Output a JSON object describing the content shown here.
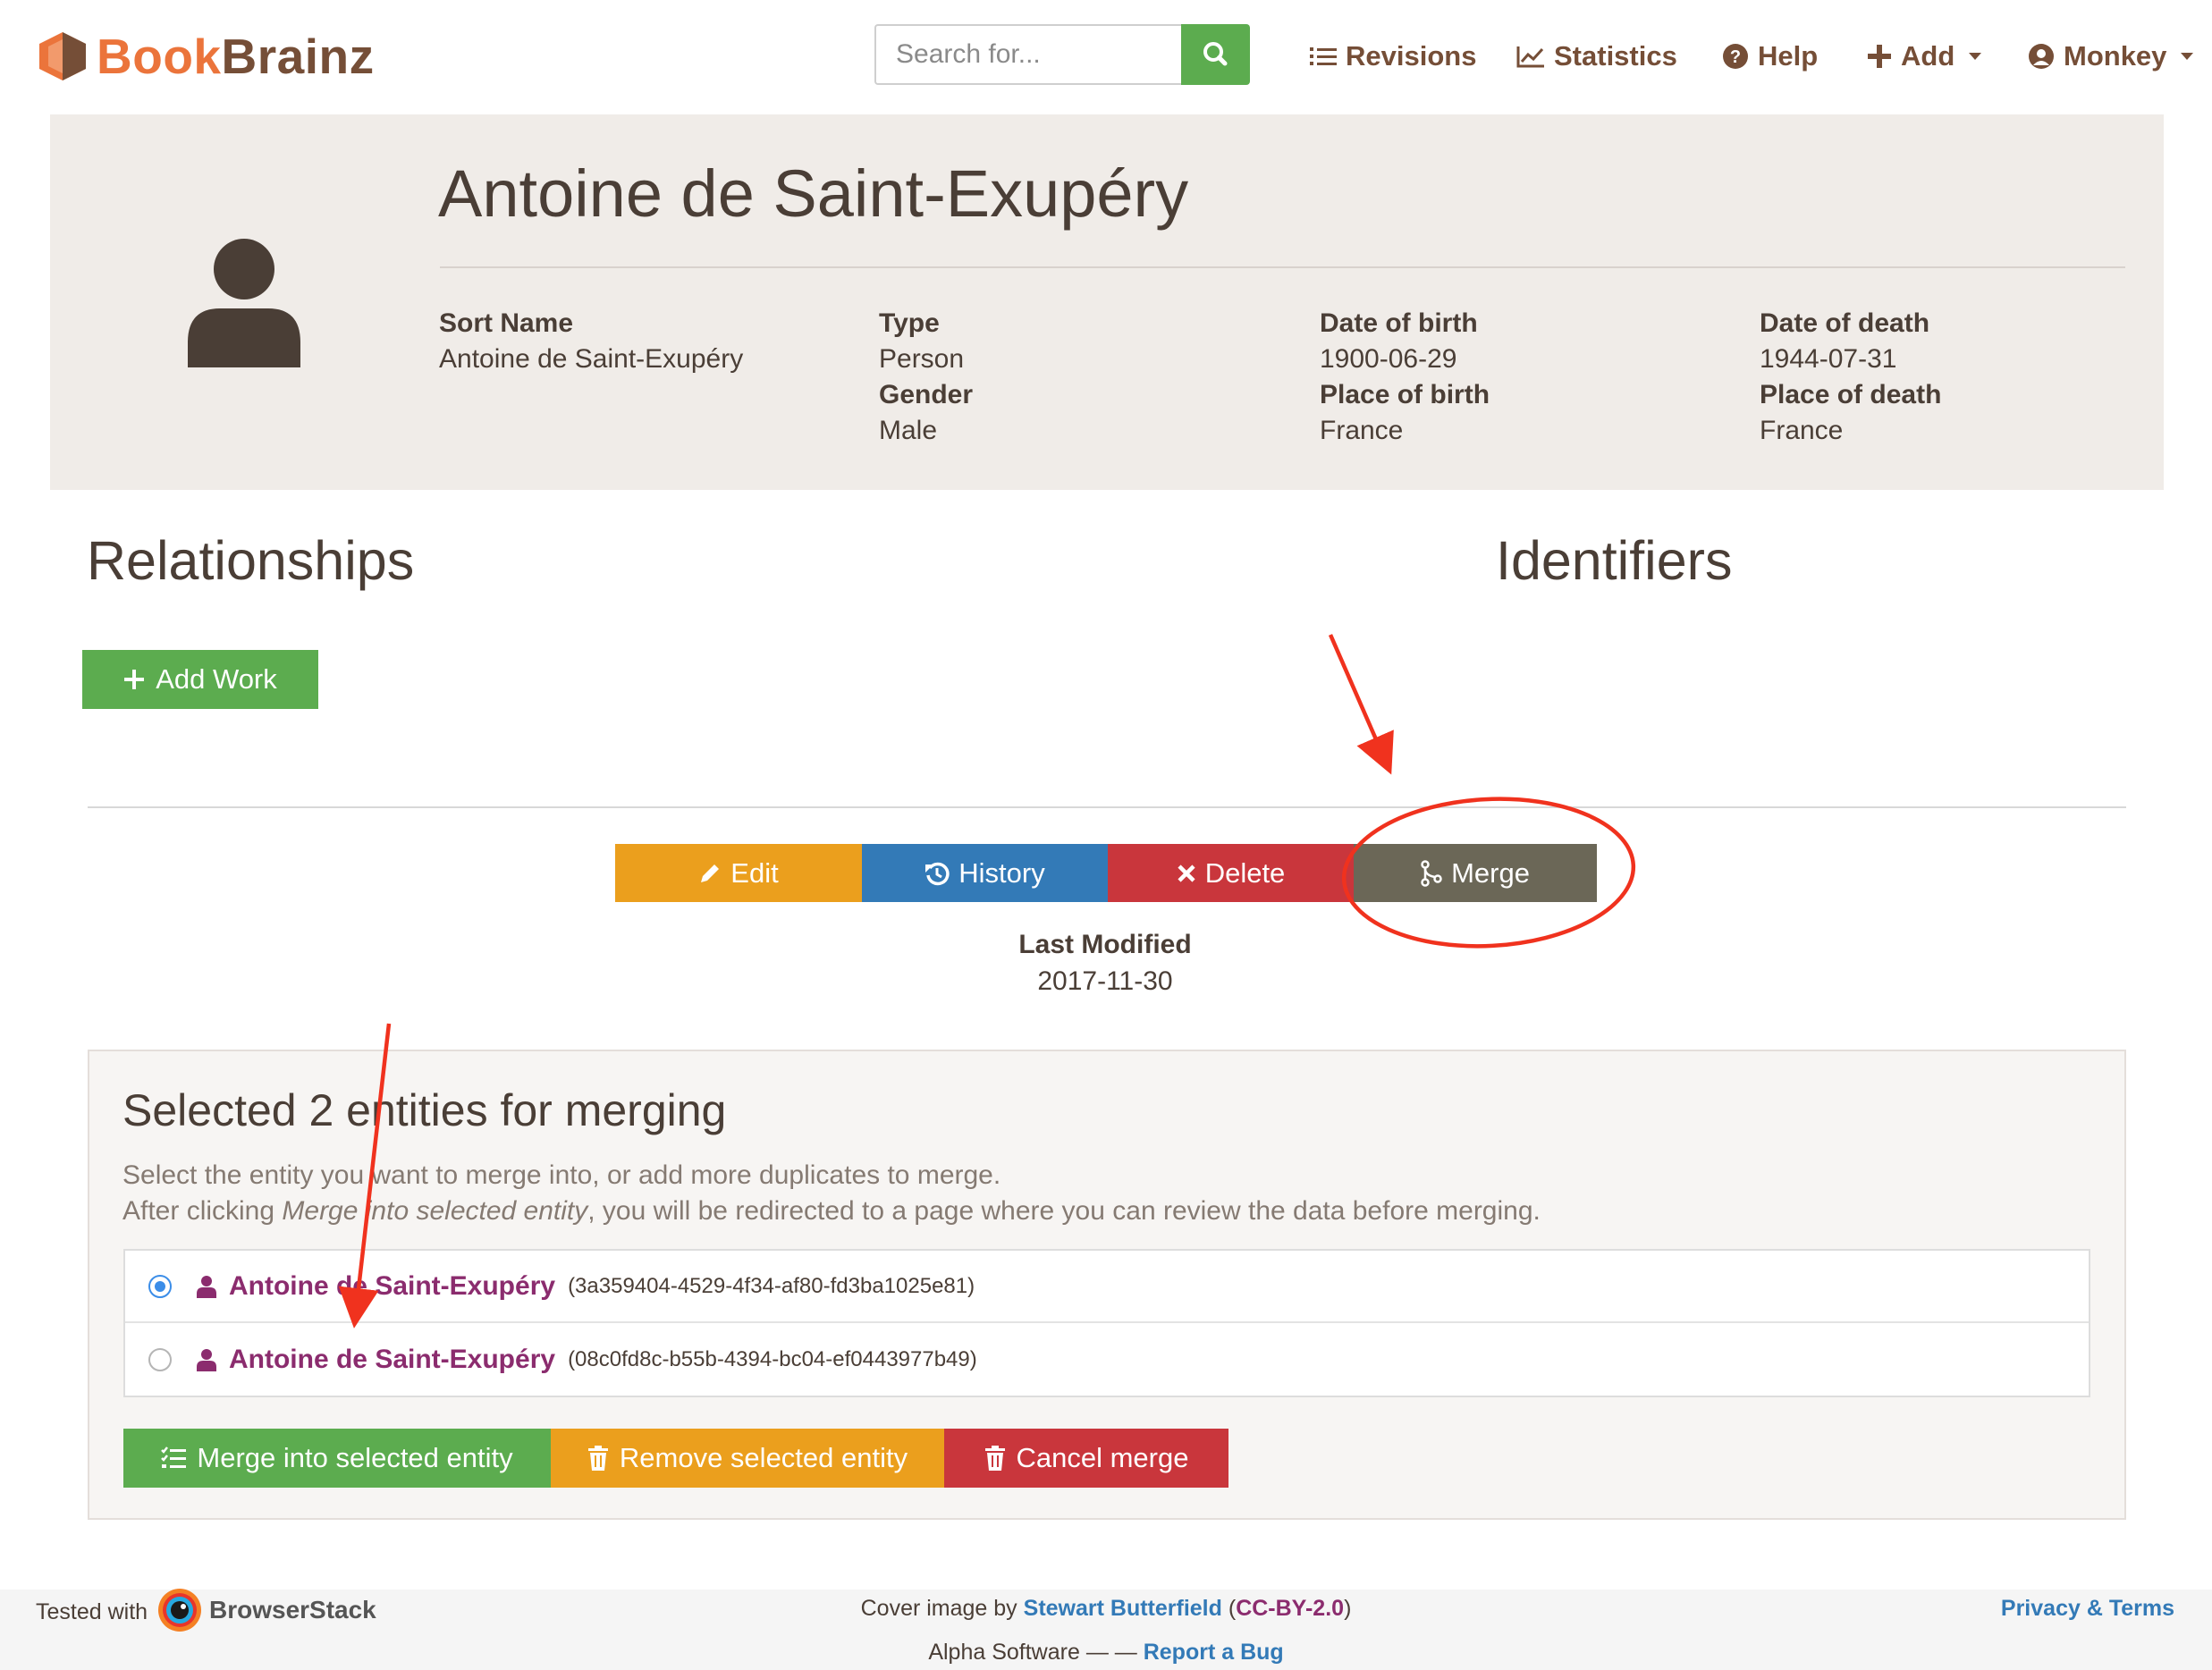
{
  "brand": {
    "name_part1": "Book",
    "name_part2": "Brainz"
  },
  "search": {
    "placeholder": "Search for..."
  },
  "nav": {
    "revisions": "Revisions",
    "statistics": "Statistics",
    "help": "Help",
    "add": "Add",
    "user": "Monkey"
  },
  "entity": {
    "title": "Antoine de Saint-Exupéry",
    "fields": {
      "sort_name_label": "Sort Name",
      "sort_name": "Antoine de Saint-Exupéry",
      "type_label": "Type",
      "type": "Person",
      "gender_label": "Gender",
      "gender": "Male",
      "dob_label": "Date of birth",
      "dob": "1900-06-29",
      "pob_label": "Place of birth",
      "pob": "France",
      "dod_label": "Date of death",
      "dod": "1944-07-31",
      "pod_label": "Place of death",
      "pod": "France"
    }
  },
  "sections": {
    "relationships": "Relationships",
    "identifiers": "Identifiers",
    "add_work": "Add Work"
  },
  "actions": {
    "edit": "Edit",
    "history": "History",
    "delete": "Delete",
    "merge": "Merge"
  },
  "last_modified": {
    "label": "Last Modified",
    "value": "2017-11-30"
  },
  "merge_panel": {
    "title": "Selected 2 entities for merging",
    "line1": "Select the entity you want to merge into, or add more duplicates to merge.",
    "line2_pre": "After clicking ",
    "line2_em": "Merge into selected entity",
    "line2_post": ", you will be redirected to a page where you can review the data before merging.",
    "entities": [
      {
        "name": "Antoine de Saint-Exupéry",
        "id": "(3a359404-4529-4f34-af80-fd3ba1025e81)",
        "selected": true
      },
      {
        "name": "Antoine de Saint-Exupéry",
        "id": "(08c0fd8c-b55b-4394-bc04-ef0443977b49)",
        "selected": false
      }
    ],
    "btn_merge": "Merge into selected entity",
    "btn_remove": "Remove selected entity",
    "btn_cancel": "Cancel merge"
  },
  "footer": {
    "tested_with": "Tested with",
    "browserstack": "BrowserStack",
    "cover_pre": "Cover image by ",
    "cover_author": "Stewart Butterfield",
    "cover_open": " (",
    "cover_license": "CC-BY-2.0",
    "cover_close": ")",
    "alpha": "Alpha Software — — ",
    "report_bug": "Report a Bug",
    "privacy": "Privacy & Terms"
  },
  "colors": {
    "brand_orange": "#eb743b",
    "brand_brown": "#754e37",
    "success": "#5cac4f",
    "warning": "#eb9f1d",
    "primary": "#337ab7",
    "danger": "#c9363c",
    "merge": "#6b6757",
    "entity_link": "#8b2c6e",
    "annotation_red": "#f0321e"
  },
  "icons": [
    "logo-hexagon-icon",
    "search-icon",
    "list-icon",
    "line-chart-icon",
    "question-circle-icon",
    "plus-icon",
    "user-circle-icon",
    "user-icon",
    "pencil-icon",
    "history-icon",
    "times-icon",
    "code-fork-icon",
    "tasks-icon",
    "trash-icon",
    "browserstack-logo-icon"
  ]
}
